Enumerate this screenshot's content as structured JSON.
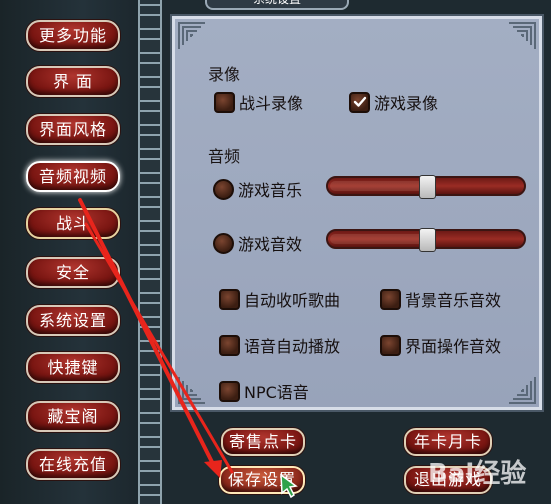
{
  "window": {
    "title": "系统设置"
  },
  "sidebar": {
    "items": [
      {
        "label": "更多功能",
        "selected": false
      },
      {
        "label": "界  面",
        "selected": false
      },
      {
        "label": "界面风格",
        "selected": false
      },
      {
        "label": "音频视频",
        "selected": true
      },
      {
        "label": "战斗",
        "selected": false
      },
      {
        "label": "安全",
        "selected": false
      },
      {
        "label": "系统设置",
        "selected": false
      },
      {
        "label": "快捷键",
        "selected": false
      },
      {
        "label": "藏宝阁",
        "selected": false
      },
      {
        "label": "在线充值",
        "selected": false
      }
    ]
  },
  "settings": {
    "recording": {
      "title": "录像",
      "battle_recording": {
        "label": "战斗录像",
        "checked": false
      },
      "game_recording": {
        "label": "游戏录像",
        "checked": true
      }
    },
    "audio": {
      "title": "音频",
      "game_music": {
        "label": "游戏音乐",
        "level": 0.5
      },
      "game_sfx": {
        "label": "游戏音效",
        "level": 0.5
      },
      "auto_listen": {
        "label": "自动收听歌曲",
        "checked": false
      },
      "bg_music_sfx": {
        "label": "背景音乐音效",
        "checked": false
      },
      "voice_autoplay": {
        "label": "语音自动播放",
        "checked": false
      },
      "ui_sfx": {
        "label": "界面操作音效",
        "checked": false
      },
      "npc_voice": {
        "label": "NPC语音",
        "checked": false
      }
    }
  },
  "buttons": {
    "consign_card": "寄售点卡",
    "year_month_card": "年卡月卡",
    "save_settings": "保存设置",
    "exit_game": "退出游戏"
  },
  "watermark": {
    "text": "Bai 经验"
  },
  "colors": {
    "button_red": "#7a1612",
    "panel_bg": "#a3aec3",
    "annotation_red": "#e8251c"
  },
  "icons": {
    "check": "check-icon",
    "cursor": "pointer-cursor-icon"
  }
}
